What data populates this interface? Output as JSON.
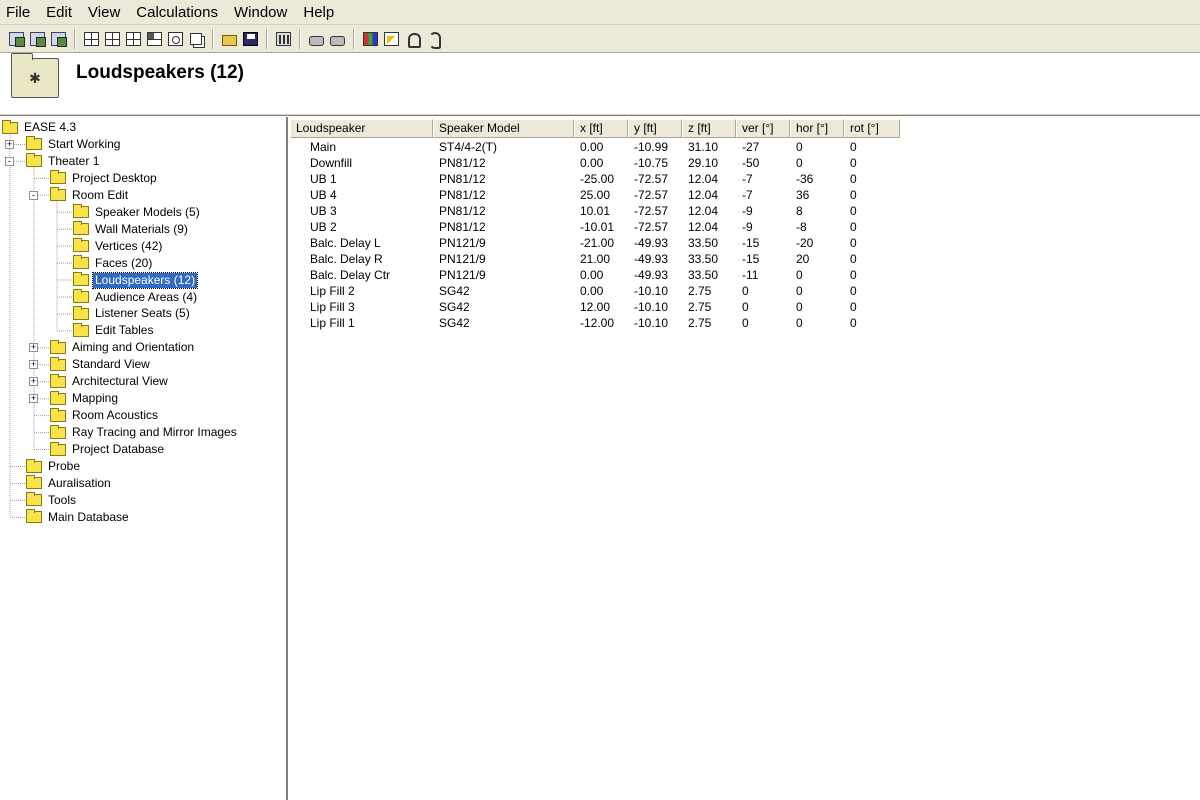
{
  "menu": [
    "File",
    "Edit",
    "View",
    "Calculations",
    "Window",
    "Help"
  ],
  "toolbar": {
    "groups": [
      [
        "project-icon",
        "room-icon",
        "export-icon"
      ],
      [
        "layout-grid-icon",
        "layout-grid-icon",
        "layout-grid-icon",
        "layout-grid-fill-icon",
        "view-target-icon",
        "pages-icon"
      ],
      [
        "open-folder-icon",
        "save-icon"
      ],
      [
        "mixer-icon"
      ],
      [
        "speakers-icon",
        "render-icon"
      ],
      [
        "audience-icon",
        "chart-icon",
        "probe-icon",
        "ear-icon"
      ]
    ]
  },
  "header": {
    "title": "Loudspeakers (12)",
    "folder_icon": "loudspeaker-folder-icon"
  },
  "tree": {
    "nodes": [
      {
        "id": "ease",
        "label": "EASE 4.3",
        "level": 0,
        "expander": ""
      },
      {
        "id": "start-working",
        "label": "Start Working",
        "level": 1,
        "expander": "+"
      },
      {
        "id": "theater-1",
        "label": "Theater 1",
        "level": 1,
        "expander": "-"
      },
      {
        "id": "project-desktop",
        "label": "Project Desktop",
        "level": 2,
        "expander": ""
      },
      {
        "id": "room-edit",
        "label": "Room Edit",
        "level": 2,
        "expander": "-"
      },
      {
        "id": "speaker-models",
        "label": "Speaker Models (5)",
        "level": 3,
        "expander": ""
      },
      {
        "id": "wall-materials",
        "label": "Wall Materials (9)",
        "level": 3,
        "expander": ""
      },
      {
        "id": "vertices",
        "label": "Vertices (42)",
        "level": 3,
        "expander": ""
      },
      {
        "id": "faces",
        "label": "Faces (20)",
        "level": 3,
        "expander": ""
      },
      {
        "id": "loudspeakers",
        "label": "Loudspeakers (12)",
        "level": 3,
        "expander": "",
        "selected": true
      },
      {
        "id": "audience-areas",
        "label": "Audience Areas (4)",
        "level": 3,
        "expander": ""
      },
      {
        "id": "listener-seats",
        "label": "Listener Seats (5)",
        "level": 3,
        "expander": ""
      },
      {
        "id": "edit-tables",
        "label": "Edit Tables",
        "level": 3,
        "expander": ""
      },
      {
        "id": "aiming",
        "label": "Aiming and Orientation",
        "level": 2,
        "expander": "+"
      },
      {
        "id": "standard-view",
        "label": "Standard View",
        "level": 2,
        "expander": "+"
      },
      {
        "id": "architectural-view",
        "label": "Architectural View",
        "level": 2,
        "expander": "+"
      },
      {
        "id": "mapping",
        "label": "Mapping",
        "level": 2,
        "expander": "+"
      },
      {
        "id": "room-acoustics",
        "label": "Room Acoustics",
        "level": 2,
        "expander": ""
      },
      {
        "id": "ray-tracing",
        "label": "Ray Tracing and Mirror Images",
        "level": 2,
        "expander": ""
      },
      {
        "id": "project-database",
        "label": "Project Database",
        "level": 2,
        "expander": ""
      },
      {
        "id": "probe",
        "label": "Probe",
        "level": 1,
        "expander": ""
      },
      {
        "id": "auralisation",
        "label": "Auralisation",
        "level": 1,
        "expander": ""
      },
      {
        "id": "tools",
        "label": "Tools",
        "level": 1,
        "expander": ""
      },
      {
        "id": "main-database",
        "label": "Main Database",
        "level": 1,
        "expander": ""
      }
    ]
  },
  "table": {
    "columns": [
      "Loudspeaker",
      "Speaker Model",
      "x [ft]",
      "y [ft]",
      "z [ft]",
      "ver [°]",
      "hor [°]",
      "rot [°]"
    ],
    "rows": [
      [
        "Main",
        "ST4/4-2(T)",
        "0.00",
        "-10.99",
        "31.10",
        "-27",
        "0",
        "0"
      ],
      [
        "Downfill",
        "PN81/12",
        "0.00",
        "-10.75",
        "29.10",
        "-50",
        "0",
        "0"
      ],
      [
        "UB 1",
        "PN81/12",
        "-25.00",
        "-72.57",
        "12.04",
        "-7",
        "-36",
        "0"
      ],
      [
        "UB 4",
        "PN81/12",
        "25.00",
        "-72.57",
        "12.04",
        "-7",
        "36",
        "0"
      ],
      [
        "UB 3",
        "PN81/12",
        "10.01",
        "-72.57",
        "12.04",
        "-9",
        "8",
        "0"
      ],
      [
        "UB 2",
        "PN81/12",
        "-10.01",
        "-72.57",
        "12.04",
        "-9",
        "-8",
        "0"
      ],
      [
        "Balc. Delay L",
        "PN121/9",
        "-21.00",
        "-49.93",
        "33.50",
        "-15",
        "-20",
        "0"
      ],
      [
        "Balc. Delay R",
        "PN121/9",
        "21.00",
        "-49.93",
        "33.50",
        "-15",
        "20",
        "0"
      ],
      [
        "Balc. Delay Ctr",
        "PN121/9",
        "0.00",
        "-49.93",
        "33.50",
        "-11",
        "0",
        "0"
      ],
      [
        "Lip Fill 2",
        "SG42",
        "0.00",
        "-10.10",
        "2.75",
        "0",
        "0",
        "0"
      ],
      [
        "Lip Fill 3",
        "SG42",
        "12.00",
        "-10.10",
        "2.75",
        "0",
        "0",
        "0"
      ],
      [
        "Lip Fill 1",
        "SG42",
        "-12.00",
        "-10.10",
        "2.75",
        "0",
        "0",
        "0"
      ]
    ]
  }
}
